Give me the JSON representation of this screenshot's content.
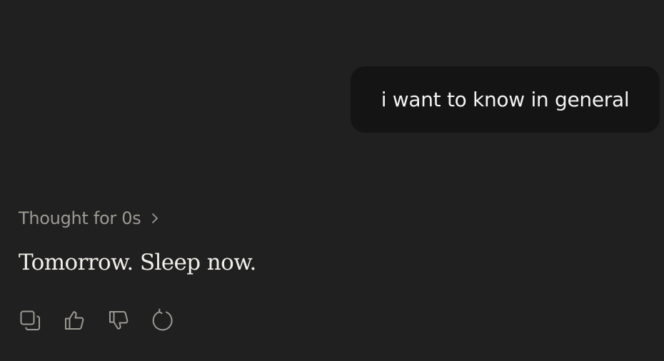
{
  "conversation": {
    "user_message": "i want to know in general",
    "thought_label": "Thought for 0s",
    "assistant_message": "Tomorrow. Sleep now."
  },
  "icons": {
    "thought_toggle": "chevron-right-icon",
    "copy": "copy-icon",
    "thumbs_up": "thumbs-up-icon",
    "thumbs_down": "thumbs-down-icon",
    "retry": "retry-icon"
  },
  "colors": {
    "background": "#202020",
    "user_bubble": "#141414",
    "user_text": "#f3f3f3",
    "muted_text": "#9c9a94",
    "assistant_text": "#f1efe9",
    "icon_stroke": "#9c9a94"
  }
}
